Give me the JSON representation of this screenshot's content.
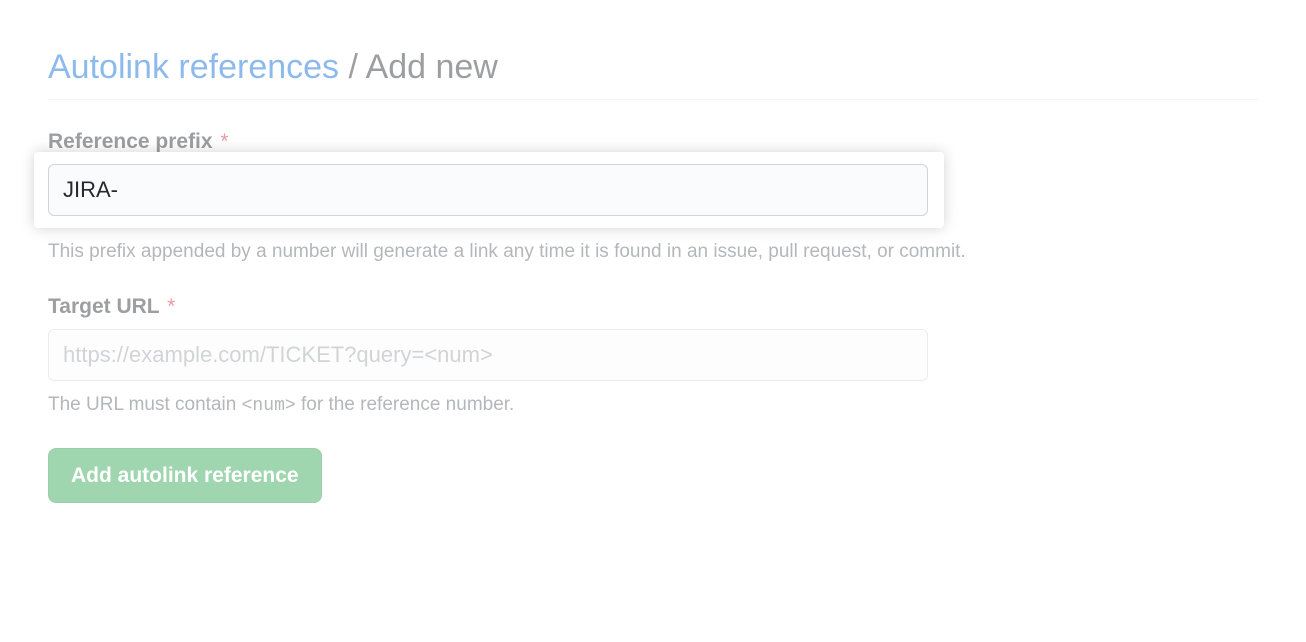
{
  "header": {
    "breadcrumb_link": "Autolink references",
    "breadcrumb_separator": "/",
    "breadcrumb_current": "Add new"
  },
  "form": {
    "prefix": {
      "label": "Reference prefix",
      "required_mark": "*",
      "value": "JIRA-",
      "help": "This prefix appended by a number will generate a link any time it is found in an issue, pull request, or commit."
    },
    "target_url": {
      "label": "Target URL",
      "required_mark": "*",
      "placeholder": "https://example.com/TICKET?query=<num>",
      "value": "",
      "help_prefix": "The URL must contain ",
      "help_code": "<num>",
      "help_suffix": " for the reference number."
    },
    "submit_label": "Add autolink reference"
  }
}
